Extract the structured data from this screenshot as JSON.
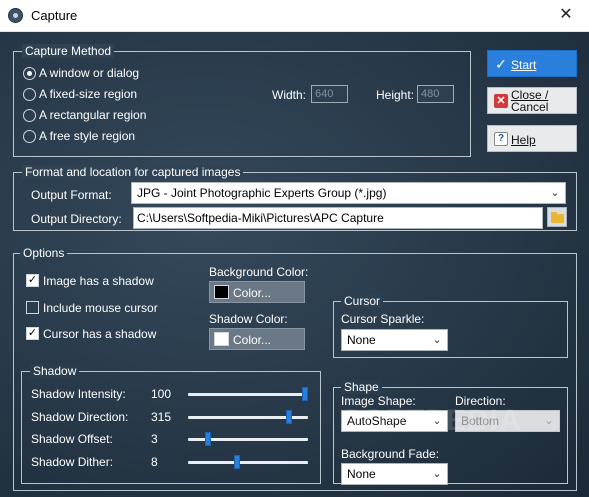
{
  "window": {
    "title": "Capture",
    "close_glyph": "✕"
  },
  "capture_method": {
    "legend": "Capture Method",
    "options": [
      {
        "label": "A window or dialog",
        "selected": true
      },
      {
        "label": "A fixed-size region",
        "selected": false
      },
      {
        "label": "A rectangular region",
        "selected": false
      },
      {
        "label": "A free style region",
        "selected": false
      }
    ],
    "width_label": "Width:",
    "width_value": "640",
    "height_label": "Height:",
    "height_value": "480"
  },
  "buttons": {
    "start": "Start",
    "close_line1": "Close /",
    "close_line2": "Cancel",
    "help": "Help"
  },
  "format": {
    "legend": "Format and location for captured images",
    "output_format_label": "Output Format:",
    "output_format_value": "JPG - Joint Photographic Experts Group (*.jpg)",
    "output_dir_label": "Output Directory:",
    "output_dir_value": "C:\\Users\\Softpedia-Miki\\Pictures\\APC Capture"
  },
  "options": {
    "legend": "Options",
    "checkboxes": [
      {
        "label": "Image has a shadow",
        "checked": true
      },
      {
        "label": "Include mouse cursor",
        "checked": false
      },
      {
        "label": "Cursor has a shadow",
        "checked": true
      }
    ],
    "background_color_label": "Background Color:",
    "background_color_button": "Color...",
    "background_color": "#000000",
    "shadow_color_label": "Shadow Color:",
    "shadow_color_button": "Color...",
    "shadow_color": "#ffffff"
  },
  "shadow": {
    "legend": "Shadow",
    "rows": [
      {
        "label": "Shadow Intensity:",
        "value": "100",
        "fraction": 1.0
      },
      {
        "label": "Shadow Direction:",
        "value": "315",
        "fraction": 0.86
      },
      {
        "label": "Shadow Offset:",
        "value": "3",
        "fraction": 0.15
      },
      {
        "label": "Shadow Dither:",
        "value": "8",
        "fraction": 0.4
      }
    ]
  },
  "cursor": {
    "legend": "Cursor",
    "sparkle_label": "Cursor Sparkle:",
    "sparkle_value": "None"
  },
  "shape": {
    "legend": "Shape",
    "image_shape_label": "Image Shape:",
    "image_shape_value": "AutoShape",
    "direction_label": "Direction:",
    "direction_value": "Bottom",
    "background_fade_label": "Background Fade:",
    "background_fade_value": "None"
  },
  "watermark": "SOFTPEDIA"
}
